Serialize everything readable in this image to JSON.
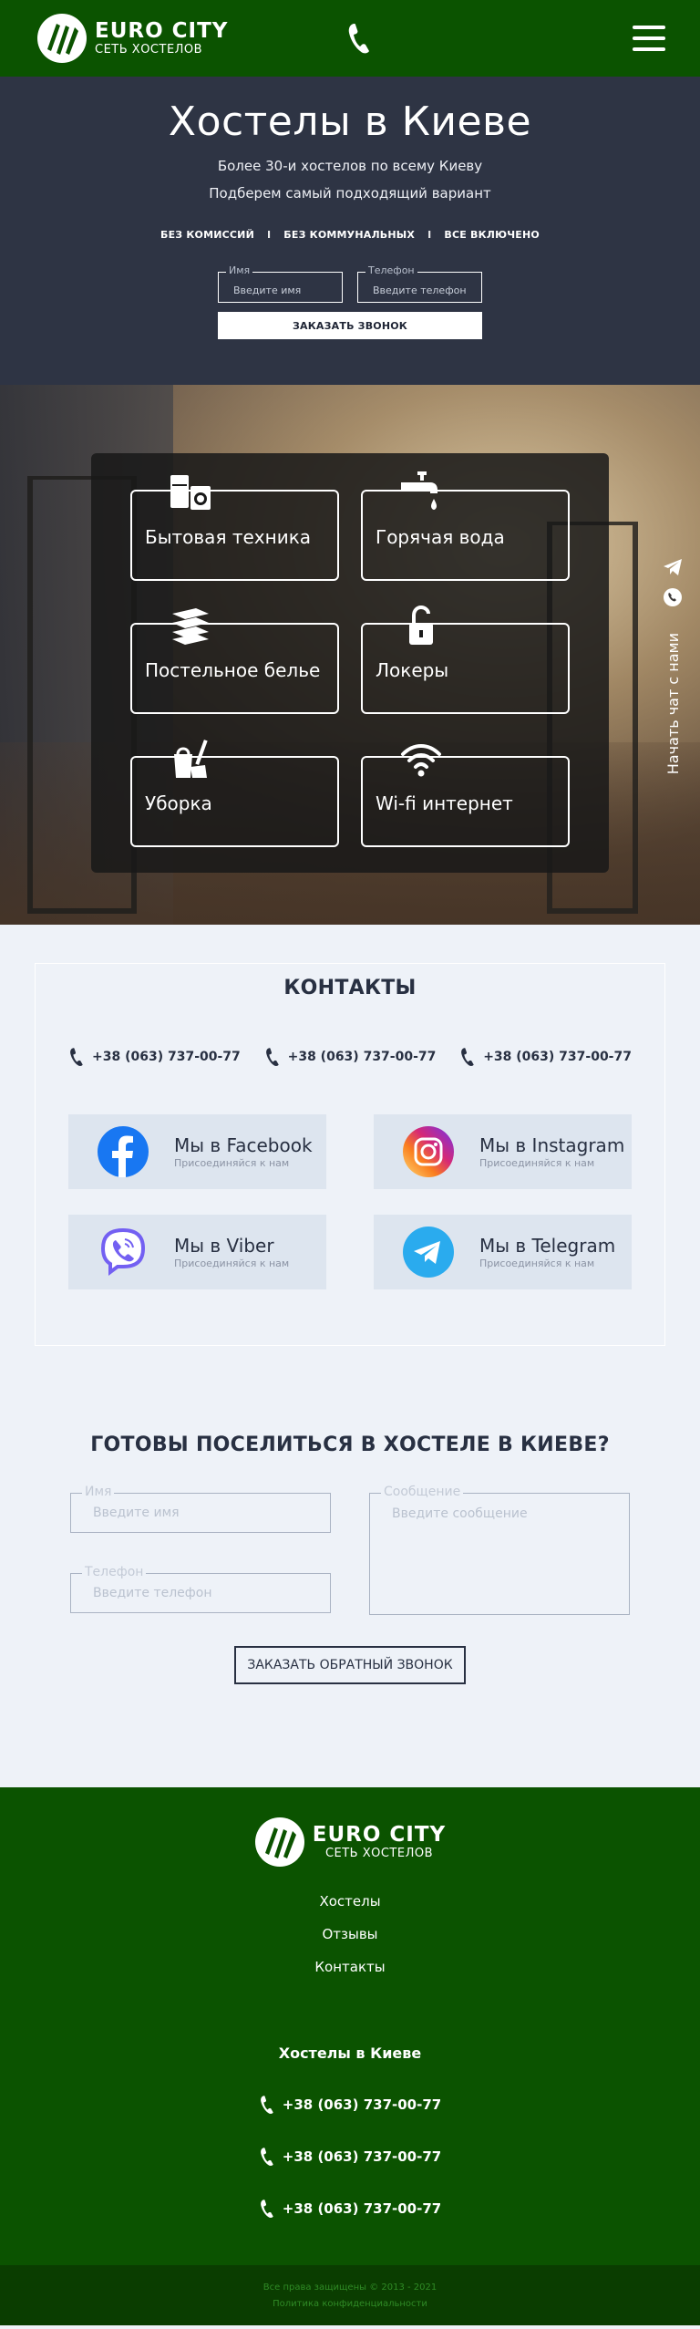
{
  "header": {
    "brand_title": "EURO CITY",
    "brand_sub": "СЕТЬ ХОСТЕЛОВ",
    "phone_icon": "phone-icon",
    "menu_icon": "menu-icon",
    "brand_color": "#0b5300"
  },
  "hero": {
    "title": "Хостелы в Киеве",
    "line1": "Более 30-и хостелов по всему Киеву",
    "line2": "Подберем самый подходящий вариант",
    "features": [
      "БЕЗ КОМИССИЙ",
      "БЕЗ КОММУНАЛЬНЫХ",
      "ВСЕ ВКЛЮЧЕНО"
    ],
    "separator": "I",
    "name_label": "Имя",
    "name_placeholder": "Введите имя",
    "phone_label": "Телефон",
    "phone_placeholder": "Введите телефон",
    "button": "ЗАКАЗАТЬ ЗВОНОК",
    "background": "#2e3444"
  },
  "amenities": {
    "items": [
      {
        "label": "Бытовая техника",
        "icon": "appliances-icon"
      },
      {
        "label": "Горячая вода",
        "icon": "faucet-icon"
      },
      {
        "label": "Постельное белье",
        "icon": "linen-icon"
      },
      {
        "label": "Локеры",
        "icon": "lock-icon"
      },
      {
        "label": "Уборка",
        "icon": "cleaning-icon"
      },
      {
        "label": "Wi-fi интернет",
        "icon": "wifi-icon"
      }
    ],
    "chat_text": "Начать чат с нами",
    "chat_icons": [
      "telegram-icon",
      "viber-icon"
    ]
  },
  "contacts": {
    "title": "КОНТАКТЫ",
    "phones": [
      "+38 (063) 737-00-77",
      "+38 (063) 737-00-77",
      "+38 (063) 737-00-77"
    ],
    "socials": [
      {
        "name": "Мы в Facebook",
        "sub": "Присоединяйся к нам",
        "icon": "facebook-icon"
      },
      {
        "name": "Мы в Instagram",
        "sub": "Присоединяйся к нам",
        "icon": "instagram-icon"
      },
      {
        "name": "Мы в Viber",
        "sub": "Присоединяйся к нам",
        "icon": "viber-icon"
      },
      {
        "name": "Мы в Telegram",
        "sub": "Присоединяйся к нам",
        "icon": "telegram-icon"
      }
    ]
  },
  "cta": {
    "title": "ГОТОВЫ ПОСЕЛИТЬСЯ В ХОСТЕЛЕ В КИЕВЕ?",
    "name_label": "Имя",
    "name_placeholder": "Введите имя",
    "phone_label": "Телефон",
    "phone_placeholder": "Введите телефон",
    "message_label": "Сообщение",
    "message_placeholder": "Введите сообщение",
    "button": "ЗАКАЗАТЬ ОБРАТНЫЙ ЗВОНОК"
  },
  "footer": {
    "brand_title": "EURO CITY",
    "brand_sub": "СЕТЬ ХОСТЕЛОВ",
    "nav": [
      "Хостелы",
      "Отзывы",
      "Контакты"
    ],
    "city": "Хостелы в Киеве",
    "phones": [
      "+38 (063) 737-00-77",
      "+38 (063) 737-00-77",
      "+38 (063) 737-00-77"
    ],
    "copyright": "Все права защищены © 2013 - 2021",
    "policy": "Политика конфиденциальности"
  }
}
